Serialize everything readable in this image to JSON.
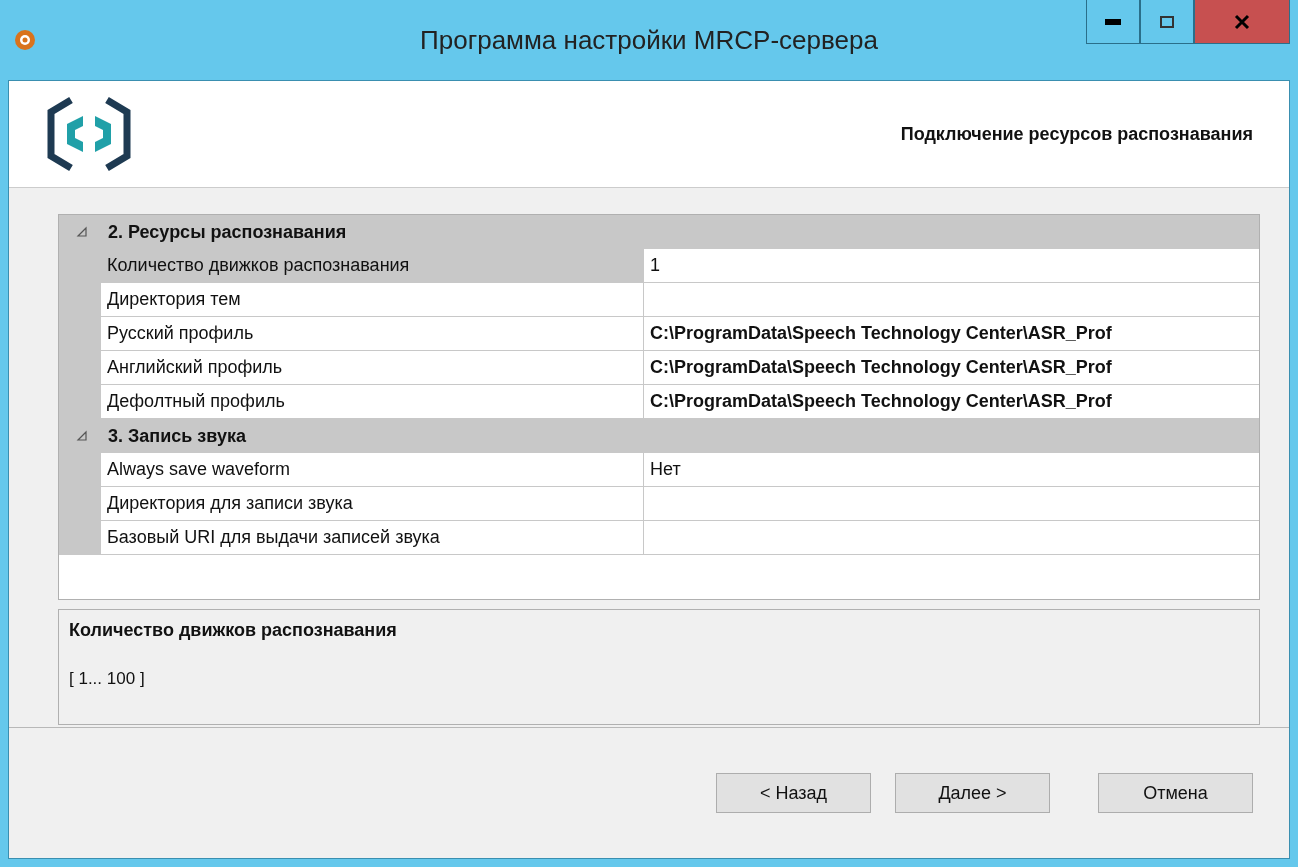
{
  "window": {
    "title": "Программа настройки MRCP-сервера"
  },
  "header": {
    "title": "Подключение ресурсов распознавания"
  },
  "groups": [
    {
      "title": "2. Ресурсы распознавания",
      "expanded": true,
      "rows": [
        {
          "name": "Количество движков распознавания",
          "value": "1",
          "selected": true,
          "modified": false
        },
        {
          "name": "Директория тем",
          "value": "",
          "selected": false,
          "modified": false
        },
        {
          "name": "Русский профиль",
          "value": "C:\\ProgramData\\Speech Technology Center\\ASR_Prof",
          "selected": false,
          "modified": true
        },
        {
          "name": "Английский профиль",
          "value": "C:\\ProgramData\\Speech Technology Center\\ASR_Prof",
          "selected": false,
          "modified": true
        },
        {
          "name": "Дефолтный профиль",
          "value": "C:\\ProgramData\\Speech Technology Center\\ASR_Prof",
          "selected": false,
          "modified": true
        }
      ]
    },
    {
      "title": "3. Запись звука",
      "expanded": true,
      "rows": [
        {
          "name": "Always save waveform",
          "value": "Нет",
          "selected": false,
          "modified": false
        },
        {
          "name": "Директория для записи звука",
          "value": "",
          "selected": false,
          "modified": false
        },
        {
          "name": "Базовый URI для выдачи записей звука",
          "value": "",
          "selected": false,
          "modified": false
        }
      ]
    }
  ],
  "description": {
    "title": "Количество движков распознавания",
    "text": "[ 1... 100 ]"
  },
  "buttons": [
    "< Назад",
    "Далее >",
    "Отмена"
  ]
}
